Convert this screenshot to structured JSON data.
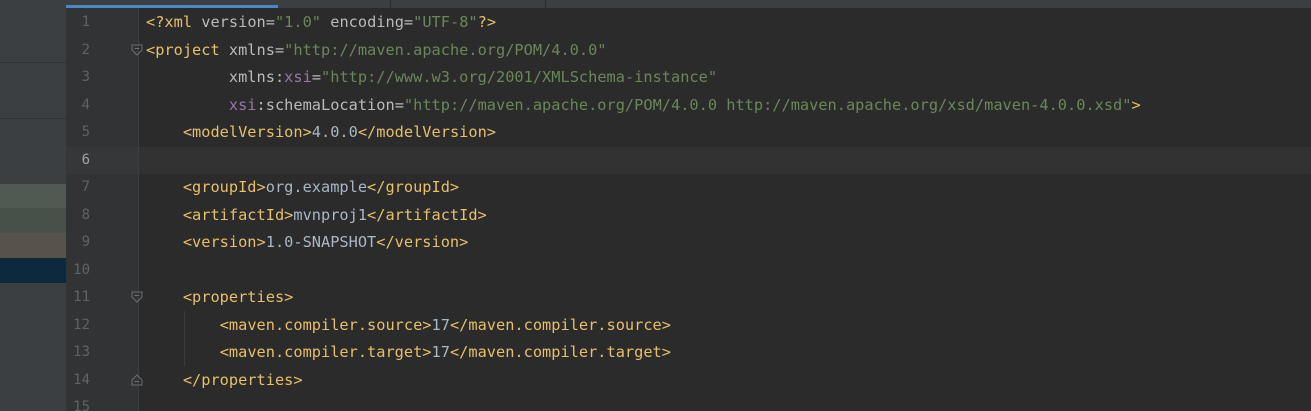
{
  "editor": {
    "colors": {
      "background": "#2b2b2b",
      "gutter": "#313335",
      "tag": "#e8bf6a",
      "attribute": "#bababa",
      "namespace": "#9876aa",
      "string": "#6a8759",
      "text": "#a9b7c6",
      "line_number": "#606366",
      "active_tab_underline": "#4a88c7"
    },
    "current_line": 6,
    "line_numbers": [
      "1",
      "2",
      "3",
      "4",
      "5",
      "6",
      "7",
      "8",
      "9",
      "10",
      "11",
      "12",
      "13",
      "14",
      "15"
    ],
    "code": {
      "l1": {
        "open": "<?xml ",
        "a1": "version",
        "eq1": "=",
        "v1": "\"1.0\"",
        "sp": " ",
        "a2": "encoding",
        "eq2": "=",
        "v2": "\"UTF-8\"",
        "close": "?>"
      },
      "l2": {
        "open": "<project ",
        "a1": "xmlns",
        "eq1": "=",
        "v1": "\"http://maven.apache.org/POM/4.0.0\""
      },
      "l3": {
        "indent": "         ",
        "prefix": "xmlns",
        "colon": ":",
        "ns": "xsi",
        "eq": "=",
        "v": "\"http://www.w3.org/2001/XMLSchema-instance\""
      },
      "l4": {
        "indent": "         ",
        "ns": "xsi",
        "colon": ":",
        "name": "schemaLocation",
        "eq": "=",
        "v": "\"http://maven.apache.org/POM/4.0.0 http://maven.apache.org/xsd/maven-4.0.0.xsd\"",
        "close": ">"
      },
      "l5": {
        "indent": "    ",
        "open": "<modelVersion>",
        "text": "4.0.0",
        "close": "</modelVersion>"
      },
      "l7": {
        "indent": "    ",
        "open": "<groupId>",
        "text": "org.example",
        "close": "</groupId>"
      },
      "l8": {
        "indent": "    ",
        "open": "<artifactId>",
        "text": "mvnproj1",
        "close": "</artifactId>"
      },
      "l9": {
        "indent": "    ",
        "open": "<version>",
        "text": "1.0-SNAPSHOT",
        "close": "</version>"
      },
      "l11": {
        "indent": "    ",
        "open": "<properties>"
      },
      "l12": {
        "indent": "        ",
        "open": "<maven.compiler.source>",
        "text": "17",
        "close": "</maven.compiler.source>"
      },
      "l13": {
        "indent": "        ",
        "open": "<maven.compiler.target>",
        "text": "17",
        "close": "</maven.compiler.target>"
      },
      "l14": {
        "indent": "    ",
        "close": "</properties>"
      }
    }
  }
}
